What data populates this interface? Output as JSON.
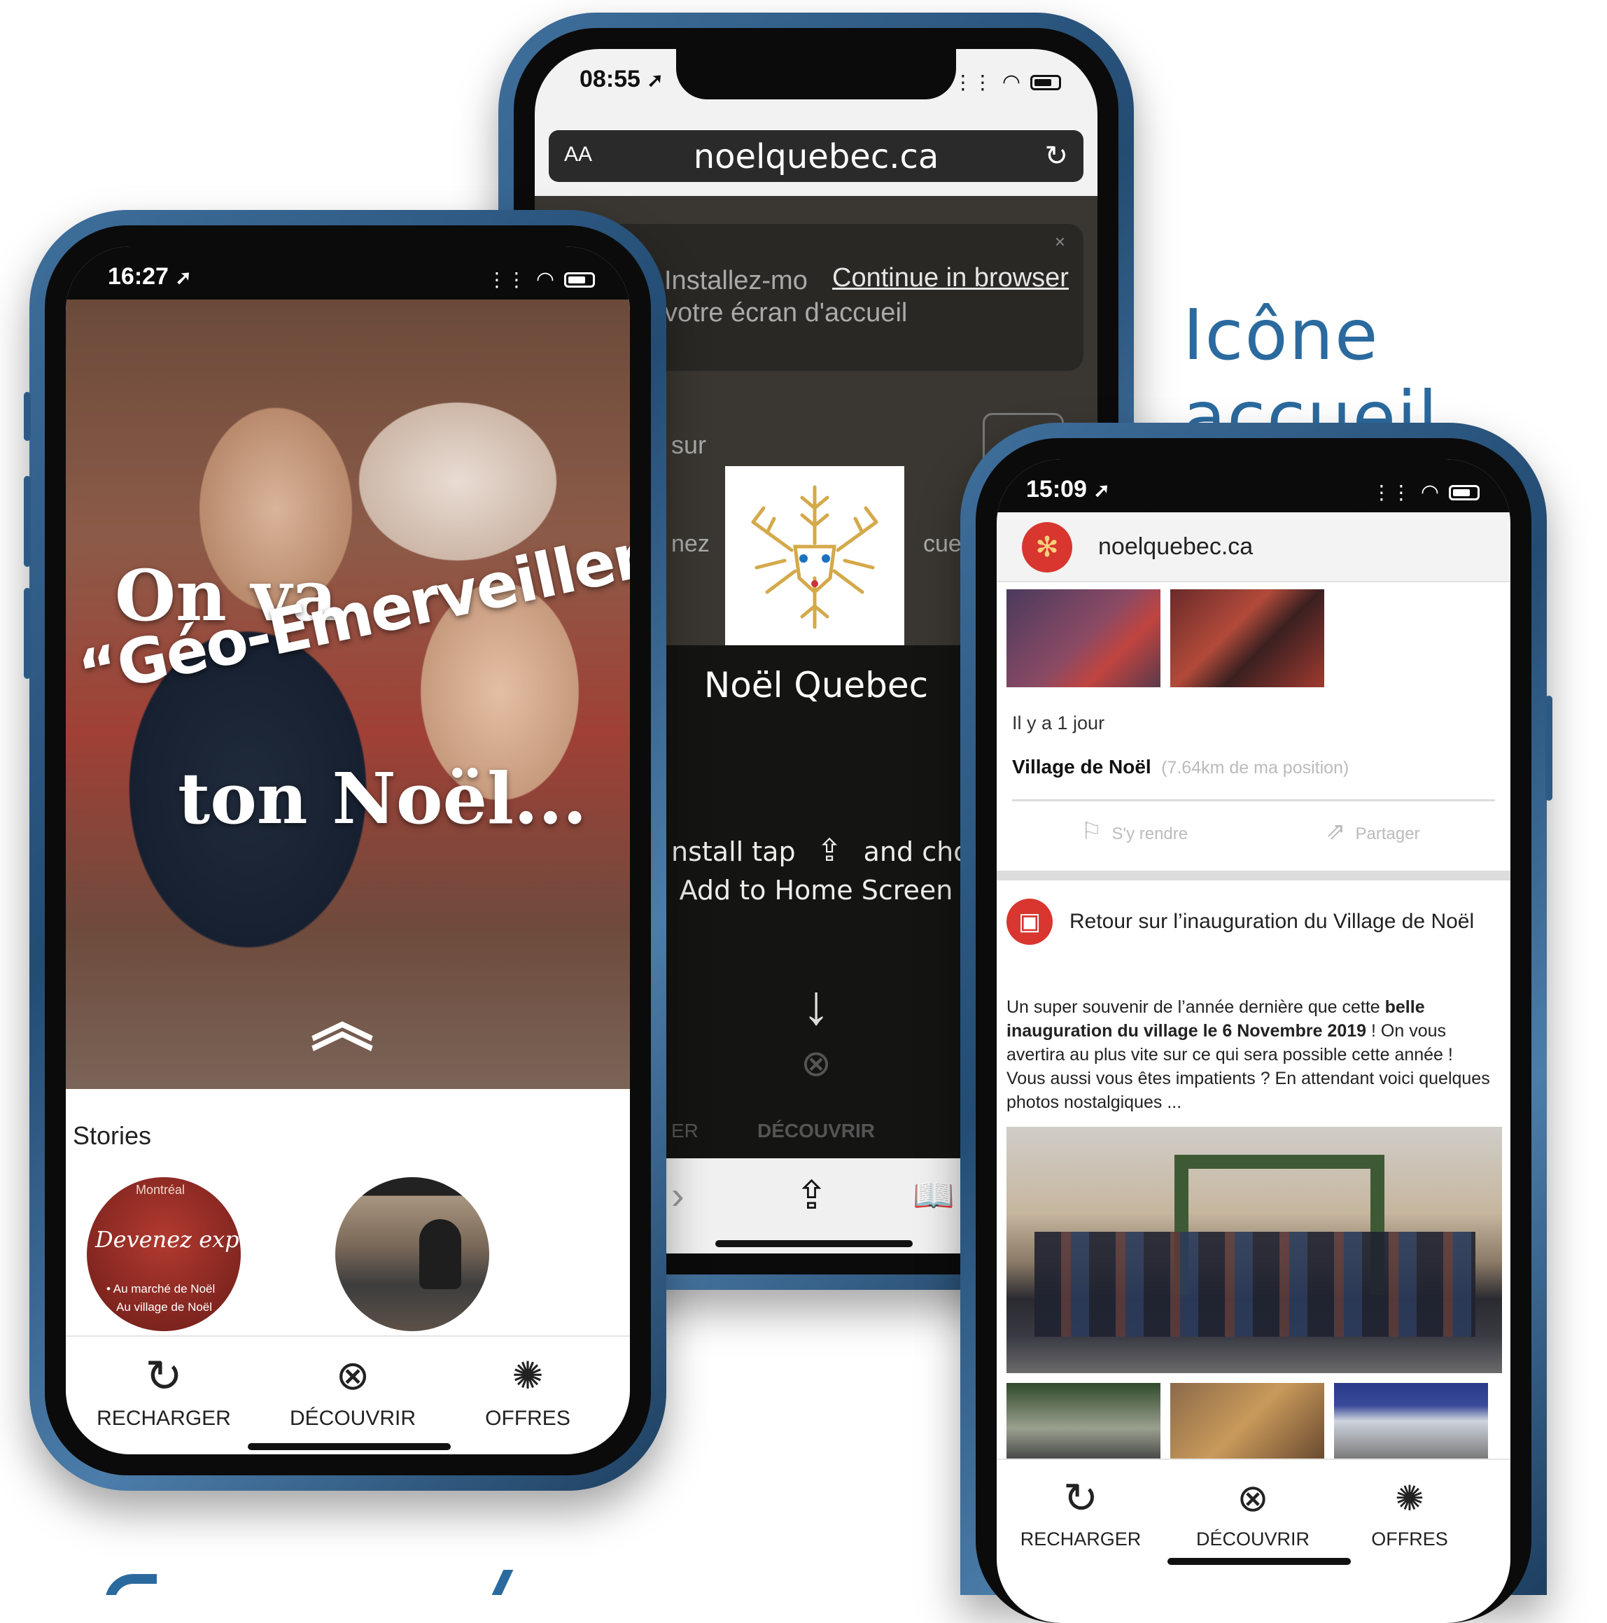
{
  "heading_right": "Icône accueil",
  "phone_left": {
    "time": "16:27",
    "hero_line1": "On va",
    "hero_line2": "“Géo-Emerveiller”",
    "hero_line3": "ton Noël...",
    "stories_label": "Stories",
    "story1_top": "Montréal",
    "story1_title": "Devenez exposant",
    "story1_sub1": "• Au marché de Noël",
    "story1_sub2": "Au village de Noël",
    "nav": [
      "RECHARGER",
      "DÉCOUVRIR",
      "OFFRES"
    ]
  },
  "phone_middle": {
    "time": "08:55",
    "aa": "AA",
    "url": "noelquebec.ca",
    "install_line1": "Installez-mo",
    "install_line2": "votre écran d'accueil",
    "continue_link": "Continue in browser",
    "frag_sur": "sur",
    "frag_nez": "nez",
    "frag_cueil": "cueil",
    "app_name": "Noël Quebec",
    "tap_line1a": "nstall tap",
    "tap_line1b": "and choo",
    "tap_line2": "Add to Home Screen",
    "bg_nav_frag": "ER",
    "bg_nav": "DÉCOUVRIR"
  },
  "phone_right": {
    "time": "15:09",
    "site": "noelquebec.ca",
    "time_ago": "Il y a 1 jour",
    "place": "Village de Noël",
    "distance": "(7.64km de ma position)",
    "action_go": "S'y rendre",
    "action_share": "Partager",
    "post_title": "Retour sur l’inauguration du Village de Noël",
    "post_body_1": "Un super souvenir de l’année dernière que cette ",
    "post_body_bold1": "belle",
    "post_body_bold2": "inauguration du village le 6 Novembre 2019",
    "post_body_2": " ! On vous avertira au plus vite sur ce qui sera possible cette année ! Vous aussi vous êtes impatients ? En attendant voici quelques photos nostalgiques ...",
    "nav": [
      "RECHARGER",
      "DÉCOUVRIR",
      "OFFRES"
    ]
  },
  "colors": {
    "accent_blue": "#2b6a9e",
    "brand_red": "#d8362e",
    "phone_frame": "#2f5e8a",
    "gold": "#d4a94a"
  }
}
